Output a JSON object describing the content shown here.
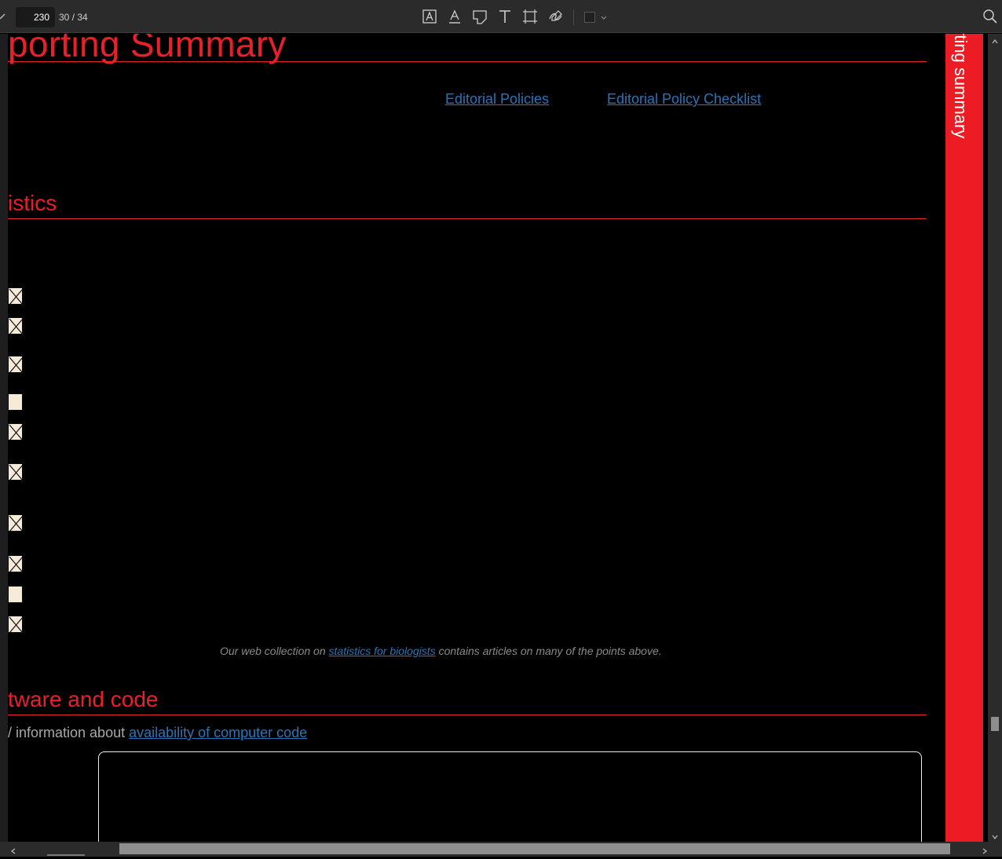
{
  "toolbar": {
    "page_input": "230",
    "page_count": "30 / 34",
    "icons": [
      "text-box-icon",
      "text-underline-icon",
      "sticky-note-icon",
      "text-tool-icon",
      "area-select-icon",
      "sign-icon"
    ]
  },
  "doc": {
    "title": "porting Summary",
    "links": {
      "editorial_policies": "Editorial Policies",
      "editorial_checklist": "Editorial Policy Checklist"
    },
    "statistics_heading": "istics",
    "checkboxes": [
      {
        "checked": true
      },
      {
        "checked": true
      },
      {
        "checked": true
      },
      {
        "checked": false
      },
      {
        "checked": true
      },
      {
        "checked": true
      },
      {
        "checked": true
      },
      {
        "checked": true
      },
      {
        "checked": false
      },
      {
        "checked": true
      }
    ],
    "note": {
      "prefix": "Our web collection on ",
      "link": "statistics for biologists",
      "suffix": " contains articles on many of the points above."
    },
    "software_heading": "tware and code",
    "code_info": {
      "prefix": "/ information about ",
      "link": "availability of computer code"
    }
  },
  "side_tab": {
    "label": "rting summary"
  },
  "colors": {
    "accent": "#e8202a",
    "tab": "#ec1c24",
    "link": "#2b74b8",
    "checkbox": "#f6ebd9"
  }
}
